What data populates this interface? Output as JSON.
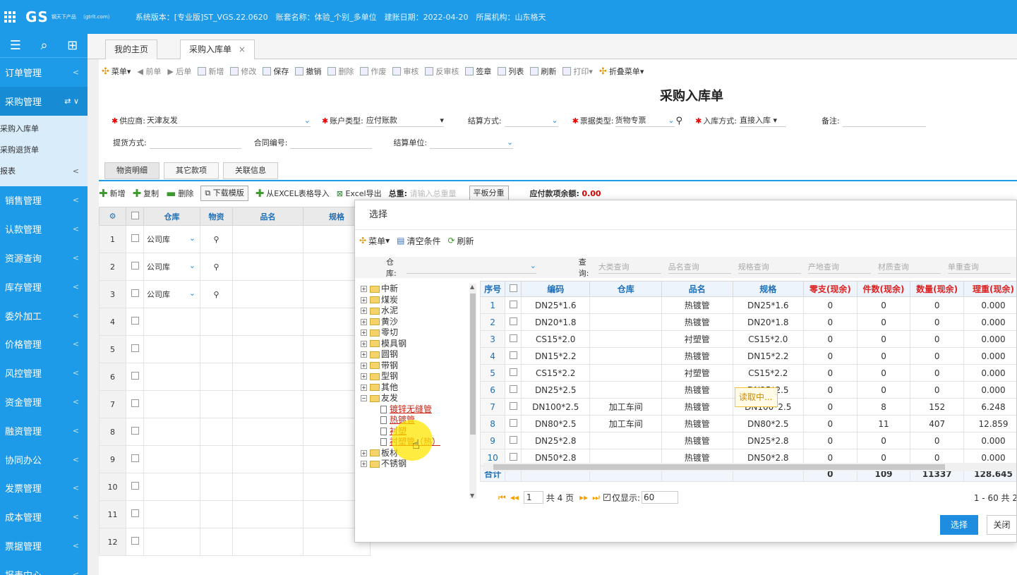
{
  "app": {
    "logo": "GS",
    "logo_sub": "钢天下产品",
    "logo_url": "（gtrlt.com）",
    "sysinfo": "系统版本：[专业版]ST_VGS.22.0620　账套名称：体验_个别_多单位　建账日期：2022-04-20　所属机构：山东格天"
  },
  "sidebar": {
    "items": [
      {
        "label": "订单管理"
      },
      {
        "label": "采购管理"
      },
      {
        "label": "销售管理"
      },
      {
        "label": "认款管理"
      },
      {
        "label": "资源查询"
      },
      {
        "label": "库存管理"
      },
      {
        "label": "委外加工"
      },
      {
        "label": "价格管理"
      },
      {
        "label": "风控管理"
      },
      {
        "label": "资金管理"
      },
      {
        "label": "融资管理"
      },
      {
        "label": "协同办公"
      },
      {
        "label": "发票管理"
      },
      {
        "label": "成本管理"
      },
      {
        "label": "票据管理"
      },
      {
        "label": "报表中心"
      }
    ],
    "sub_items": [
      {
        "label": "采购入库单"
      },
      {
        "label": "采购退货单"
      },
      {
        "label": "报表"
      }
    ]
  },
  "tabs": {
    "home": "我的主页",
    "active": "采购入库单"
  },
  "toolbar": {
    "menu": "菜单",
    "prev": "前单",
    "next": "后单",
    "new": "新增",
    "edit": "修改",
    "save": "保存",
    "undo": "撤销",
    "delete": "删除",
    "void": "作废",
    "audit": "审核",
    "unaudit": "反审核",
    "sign": "签章",
    "list": "列表",
    "refresh": "刷新",
    "print": "打印",
    "fold": "折叠菜单"
  },
  "form": {
    "title": "采购入库单",
    "supplier_label": "供应商:",
    "supplier_value": "天津友发",
    "account_type_label": "账户类型:",
    "account_type_value": "应付账款",
    "settle_label": "结算方式:",
    "invoice_type_label": "票据类型:",
    "invoice_type_value": "货物专票",
    "inbound_label": "入库方式:",
    "inbound_value": "直接入库",
    "remark_label": "备注:",
    "pickup_label": "提货方式:",
    "contract_label": "合同编号:",
    "settle_unit_label": "结算单位:"
  },
  "subtabs": [
    "物资明细",
    "其它款项",
    "关联信息"
  ],
  "gridtools": {
    "add": "新增",
    "copy": "复制",
    "del": "删除",
    "download": "下载模版",
    "import": "从EXCEL表格导入",
    "export": "Excel导出",
    "total_weight_label": "总重:",
    "total_weight_placeholder": "请输入总重量",
    "split": "平板分重",
    "payable_label": "应付款项余额:",
    "payable_value": "0.00"
  },
  "bg_grid": {
    "headers": [
      "仓库",
      "物资",
      "品名",
      "规格"
    ],
    "rows": [
      {
        "n": "1",
        "wh": "公司库"
      },
      {
        "n": "2",
        "wh": "公司库"
      },
      {
        "n": "3",
        "wh": "公司库"
      },
      {
        "n": "4",
        "wh": ""
      },
      {
        "n": "5",
        "wh": ""
      },
      {
        "n": "6",
        "wh": ""
      },
      {
        "n": "7",
        "wh": ""
      },
      {
        "n": "8",
        "wh": ""
      },
      {
        "n": "9",
        "wh": ""
      },
      {
        "n": "10",
        "wh": ""
      },
      {
        "n": "11",
        "wh": ""
      },
      {
        "n": "12",
        "wh": ""
      }
    ]
  },
  "dialog": {
    "title": "选择",
    "menu": "菜单",
    "clear": "清空条件",
    "refresh": "刷新",
    "warehouse_label": "仓库:",
    "query_label": "查询:",
    "queries": [
      "大类查询",
      "品名查询",
      "规格查询",
      "产地查询",
      "材质查询",
      "单重查询"
    ],
    "tree": [
      {
        "label": "中新",
        "type": "folder",
        "sign": "+"
      },
      {
        "label": "煤炭",
        "type": "folder",
        "sign": "+"
      },
      {
        "label": "水泥",
        "type": "folder",
        "sign": "+"
      },
      {
        "label": "黄沙",
        "type": "folder",
        "sign": "+"
      },
      {
        "label": "零切",
        "type": "folder",
        "sign": "+"
      },
      {
        "label": "模具钢",
        "type": "folder",
        "sign": "+"
      },
      {
        "label": "圆钢",
        "type": "folder",
        "sign": "+"
      },
      {
        "label": "带钢",
        "type": "folder",
        "sign": "+"
      },
      {
        "label": "型钢",
        "type": "folder",
        "sign": "+"
      },
      {
        "label": "其他",
        "type": "folder",
        "sign": "+"
      },
      {
        "label": "友发",
        "type": "folder",
        "sign": "−"
      },
      {
        "label": "镀锌无缝管",
        "type": "leaf"
      },
      {
        "label": "热镀管",
        "type": "leaf"
      },
      {
        "label": "衬塑",
        "type": "leaf"
      },
      {
        "label": "衬塑管（热）",
        "type": "leaf"
      },
      {
        "label": "板材",
        "type": "folder",
        "sign": "+"
      },
      {
        "label": "不锈钢",
        "type": "folder",
        "sign": "+"
      }
    ],
    "grid_headers": [
      "序号",
      "",
      "编码",
      "仓库",
      "品名",
      "规格",
      "零支(现余)",
      "件数(现余)",
      "数量(现余)",
      "理重(现余)"
    ],
    "rows": [
      [
        "1",
        "DN25*1.6",
        "",
        "热镀管",
        "DN25*1.6",
        "0",
        "0",
        "0",
        "0.000"
      ],
      [
        "2",
        "DN20*1.8",
        "",
        "热镀管",
        "DN20*1.8",
        "0",
        "0",
        "0",
        "0.000"
      ],
      [
        "3",
        "CS15*2.0",
        "",
        "衬塑管",
        "CS15*2.0",
        "0",
        "0",
        "0",
        "0.000"
      ],
      [
        "4",
        "DN15*2.2",
        "",
        "热镀管",
        "DN15*2.2",
        "0",
        "0",
        "0",
        "0.000"
      ],
      [
        "5",
        "CS15*2.2",
        "",
        "衬塑管",
        "CS15*2.2",
        "0",
        "0",
        "0",
        "0.000"
      ],
      [
        "6",
        "DN25*2.5",
        "",
        "热镀管",
        "DN25*2.5",
        "0",
        "0",
        "0",
        "0.000"
      ],
      [
        "7",
        "DN100*2.5",
        "加工车间",
        "热镀管",
        "DN100*2.5",
        "0",
        "8",
        "152",
        "6.248"
      ],
      [
        "8",
        "DN80*2.5",
        "加工车间",
        "热镀管",
        "DN80*2.5",
        "0",
        "11",
        "407",
        "12.859"
      ],
      [
        "9",
        "DN25*2.8",
        "",
        "热镀管",
        "DN25*2.8",
        "0",
        "0",
        "0",
        "0.000"
      ],
      [
        "10",
        "DN50*2.8",
        "",
        "热镀管",
        "DN50*2.8",
        "0",
        "0",
        "0",
        "0.000"
      ]
    ],
    "total_label": "合计",
    "totals": [
      "0",
      "109",
      "11337",
      "128.645"
    ],
    "pager": {
      "page": "1",
      "of_pages": "共 4 页",
      "show_label": "仅显示:",
      "show_value": "60",
      "range": "1 - 60  共 2"
    },
    "select_btn": "选择",
    "close_btn": "关闭",
    "loading": "读取中..."
  }
}
